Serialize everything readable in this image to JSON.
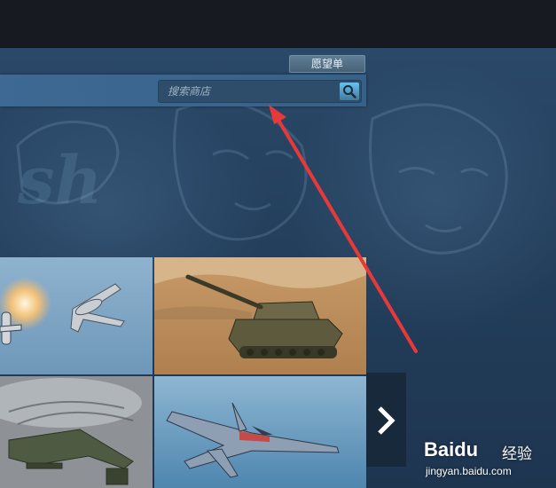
{
  "header": {
    "wishlist_label": "愿望单"
  },
  "search": {
    "placeholder": "搜索商店"
  },
  "carousel": {
    "tiles": [
      {
        "id": "plane-dogfight",
        "subject": "airplane dogfight"
      },
      {
        "id": "desert-tank",
        "subject": "tank in desert"
      },
      {
        "id": "attack-helicopter",
        "subject": "attack helicopter"
      },
      {
        "id": "jet-fighter",
        "subject": "jet fighter over sea"
      }
    ],
    "next_icon": "chevron-right-icon"
  },
  "watermark": {
    "logo": "Baidu",
    "cn": "经验",
    "url": "jingyan.baidu.com"
  },
  "colors": {
    "topbar": "#171a21",
    "nav": "#3e6b96",
    "arrow": "#e8393a",
    "search_button": "#67c1f5"
  }
}
